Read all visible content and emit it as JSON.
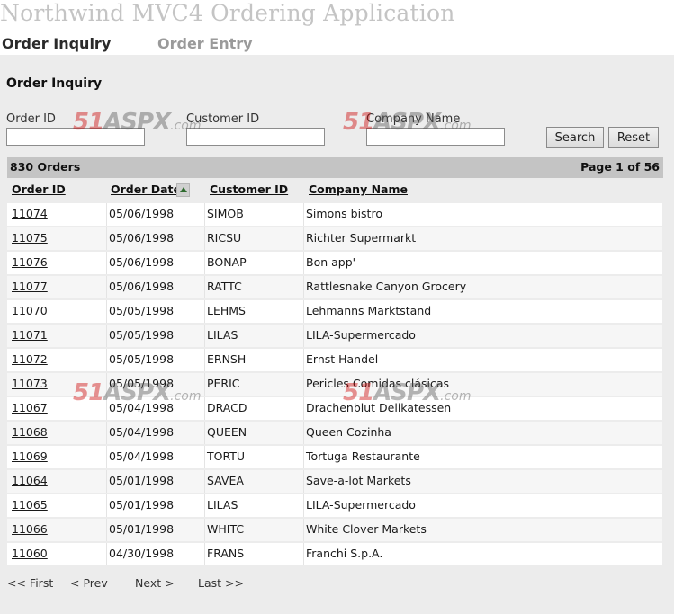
{
  "app": {
    "title": "Northwind MVC4 Ordering Application"
  },
  "nav": {
    "tabs": [
      {
        "label": "Order Inquiry"
      },
      {
        "label": "Order Entry"
      }
    ]
  },
  "page": {
    "heading": "Order Inquiry"
  },
  "search": {
    "order_id_label": "Order ID",
    "customer_id_label": "Customer ID",
    "company_name_label": "Company Name",
    "order_id_value": "",
    "customer_id_value": "",
    "company_name_value": "",
    "search_button": "Search",
    "reset_button": "Reset"
  },
  "summary": {
    "count_text": "830 Orders",
    "page_text": "Page 1 of 56"
  },
  "table": {
    "headers": {
      "order_id": "Order ID",
      "order_date": "Order Date",
      "customer_id": "Customer ID",
      "company_name": "Company Name"
    },
    "sort": {
      "column": "order_date",
      "direction": "ascending",
      "icon": "sort-up-icon"
    },
    "rows": [
      {
        "order_id": "11074",
        "order_date": "05/06/1998",
        "customer_id": "SIMOB",
        "company_name": "Simons bistro"
      },
      {
        "order_id": "11075",
        "order_date": "05/06/1998",
        "customer_id": "RICSU",
        "company_name": "Richter Supermarkt"
      },
      {
        "order_id": "11076",
        "order_date": "05/06/1998",
        "customer_id": "BONAP",
        "company_name": "Bon app'"
      },
      {
        "order_id": "11077",
        "order_date": "05/06/1998",
        "customer_id": "RATTC",
        "company_name": "Rattlesnake Canyon Grocery"
      },
      {
        "order_id": "11070",
        "order_date": "05/05/1998",
        "customer_id": "LEHMS",
        "company_name": "Lehmanns Marktstand"
      },
      {
        "order_id": "11071",
        "order_date": "05/05/1998",
        "customer_id": "LILAS",
        "company_name": "LILA-Supermercado"
      },
      {
        "order_id": "11072",
        "order_date": "05/05/1998",
        "customer_id": "ERNSH",
        "company_name": "Ernst Handel"
      },
      {
        "order_id": "11073",
        "order_date": "05/05/1998",
        "customer_id": "PERIC",
        "company_name": "Pericles Comidas clásicas"
      },
      {
        "order_id": "11067",
        "order_date": "05/04/1998",
        "customer_id": "DRACD",
        "company_name": "Drachenblut Delikatessen"
      },
      {
        "order_id": "11068",
        "order_date": "05/04/1998",
        "customer_id": "QUEEN",
        "company_name": "Queen Cozinha"
      },
      {
        "order_id": "11069",
        "order_date": "05/04/1998",
        "customer_id": "TORTU",
        "company_name": "Tortuga Restaurante"
      },
      {
        "order_id": "11064",
        "order_date": "05/01/1998",
        "customer_id": "SAVEA",
        "company_name": "Save-a-lot Markets"
      },
      {
        "order_id": "11065",
        "order_date": "05/01/1998",
        "customer_id": "LILAS",
        "company_name": "LILA-Supermercado"
      },
      {
        "order_id": "11066",
        "order_date": "05/01/1998",
        "customer_id": "WHITC",
        "company_name": "White Clover Markets"
      },
      {
        "order_id": "11060",
        "order_date": "04/30/1998",
        "customer_id": "FRANS",
        "company_name": "Franchi S.p.A."
      }
    ]
  },
  "pager": {
    "first": "<< First",
    "prev": "< Prev",
    "next": "Next >",
    "last": "Last >>"
  },
  "watermark": {
    "digits": "51",
    "name": "ASPX",
    "suffix": ".com"
  },
  "colors": {
    "panel_bg": "#ececec",
    "summary_bar": "#c4c4c4",
    "title_text": "#c4c4c4",
    "watermark_red": "#cc0000"
  }
}
